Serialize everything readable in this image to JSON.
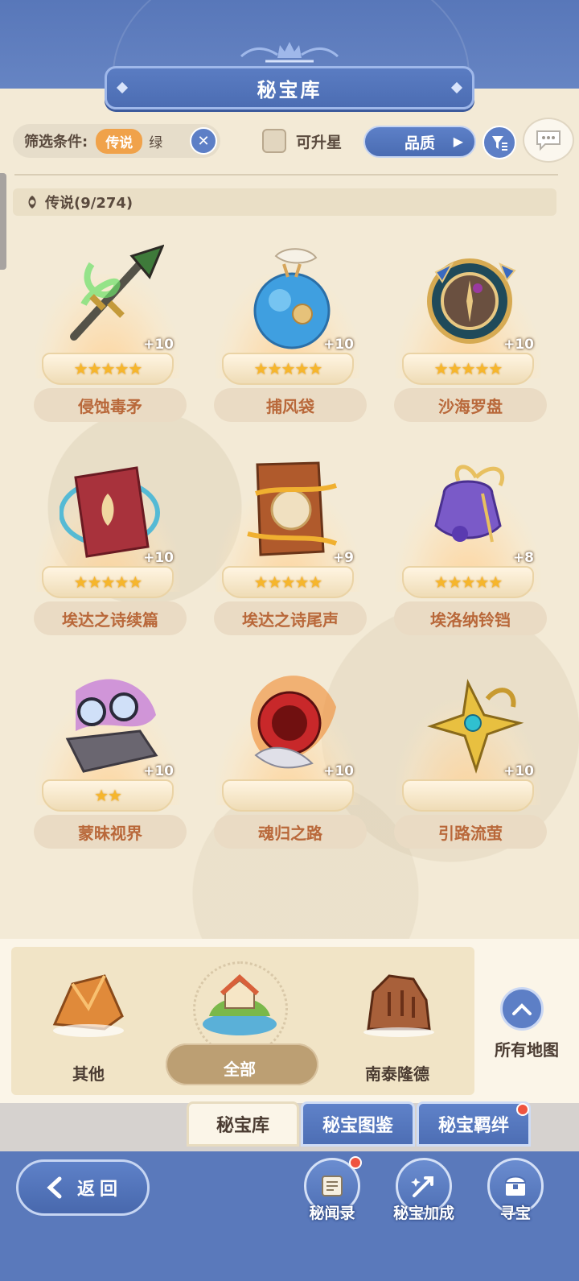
{
  "header": {
    "title": "秘宝库"
  },
  "filter": {
    "label": "筛选条件:",
    "tag": "传说",
    "tag_overflow": "绿",
    "upgradable_label": "可升星",
    "sort_label": "品质"
  },
  "section": {
    "title": "传说(9/274)"
  },
  "items": [
    {
      "name": "侵蚀毒矛",
      "level": "+10",
      "stars": "★★★★★"
    },
    {
      "name": "捕风袋",
      "level": "+10",
      "stars": "★★★★★"
    },
    {
      "name": "沙海罗盘",
      "level": "+10",
      "stars": "★★★★★"
    },
    {
      "name": "埃达之诗续篇",
      "level": "+10",
      "stars": "★★★★★"
    },
    {
      "name": "埃达之诗尾声",
      "level": "+9",
      "stars": "★★★★★"
    },
    {
      "name": "埃洛纳铃铛",
      "level": "+8",
      "stars": "★★★★★"
    },
    {
      "name": "蒙昧视界",
      "level": "+10",
      "stars": "★★"
    },
    {
      "name": "魂归之路",
      "level": "+10",
      "stars": ""
    },
    {
      "name": "引路流萤",
      "level": "+10",
      "stars": ""
    }
  ],
  "regions": [
    {
      "label": "其他"
    },
    {
      "label": "全部",
      "selected": true
    },
    {
      "label": "南泰隆德"
    }
  ],
  "all_maps_label": "所有地图",
  "tabs": [
    {
      "label": "秘宝库",
      "active": true
    },
    {
      "label": "秘宝图鉴"
    },
    {
      "label": "秘宝羁绊",
      "badge": true
    }
  ],
  "back_label": "返回",
  "nav": [
    {
      "label": "秘闻录",
      "badge": true,
      "icon": "scroll-icon"
    },
    {
      "label": "秘宝加成",
      "icon": "boost-icon"
    },
    {
      "label": "寻宝",
      "icon": "chest-icon"
    }
  ],
  "colors": {
    "accent_blue": "#5d7fc6",
    "item_name": "#b9683a",
    "star": "#f6b62c",
    "tag_orange": "#f0a24a"
  }
}
